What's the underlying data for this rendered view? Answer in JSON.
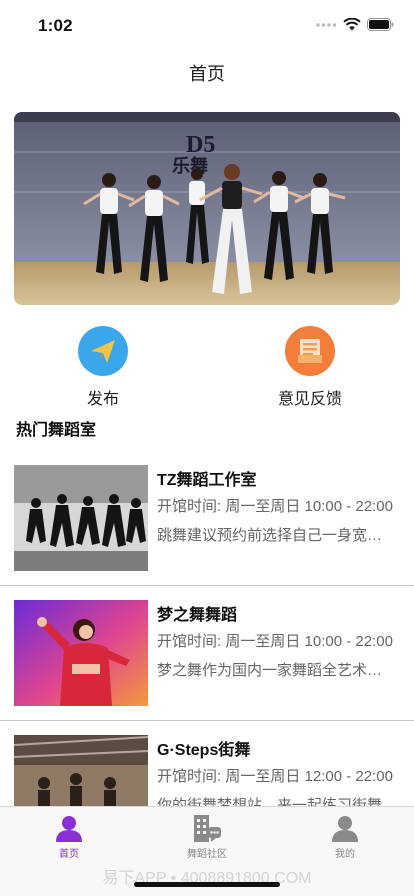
{
  "status_bar": {
    "time": "1:02"
  },
  "nav": {
    "title": "首页"
  },
  "quick_actions": [
    {
      "label": "发布",
      "icon": "paper-plane-icon",
      "color": "#3aa7ea"
    },
    {
      "label": "意见反馈",
      "icon": "feedback-icon",
      "color": "#f37d3a"
    }
  ],
  "section": {
    "title": "热门舞蹈室"
  },
  "studios": [
    {
      "name": "TZ舞蹈工作室",
      "hours": "开馆时间: 周一至周日 10:00 - 22:00",
      "desc": "跳舞建议预约前选择自己一身宽松的衣服"
    },
    {
      "name": "梦之舞舞蹈",
      "hours": "开馆时间: 周一至周日 10:00 - 22:00",
      "desc": "梦之舞作为国内一家舞蹈全艺术培训机构"
    },
    {
      "name": "G·Steps街舞",
      "hours": "开馆时间: 周一至周日 12:00 - 22:00",
      "desc": "你的街舞梦想站，来一起练习街舞"
    }
  ],
  "tabs": [
    {
      "label": "首页",
      "icon": "user-icon",
      "active": true
    },
    {
      "label": "舞蹈社区",
      "icon": "community-building-icon",
      "active": false
    },
    {
      "label": "我的",
      "icon": "profile-icon",
      "active": false
    }
  ],
  "watermark": "易下APP • 4008891800.COM",
  "colors": {
    "accent": "#8b2fd6",
    "tab_inactive": "#888888",
    "divider": "#c9c9c9"
  }
}
